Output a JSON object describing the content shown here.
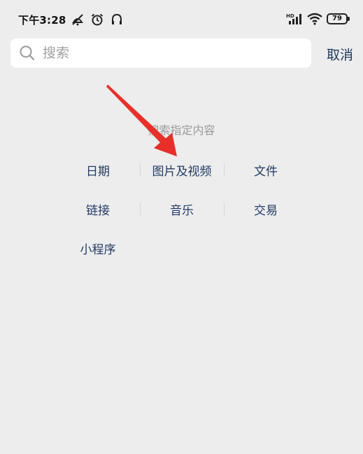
{
  "status_bar": {
    "time": "下午3:28",
    "battery": "79",
    "network_label": "HD"
  },
  "search": {
    "placeholder": "搜索",
    "value": "",
    "cancel_label": "取消"
  },
  "hint": "搜索指定内容",
  "categories": {
    "date": "日期",
    "photos_videos": "图片及视频",
    "files": "文件",
    "links": "链接",
    "music": "音乐",
    "transactions": "交易",
    "mini_programs": "小程序"
  },
  "colors": {
    "background": "#ededed",
    "category_text": "#223b66",
    "hint_text": "#9a9a9a",
    "arrow": "#e8302a"
  }
}
